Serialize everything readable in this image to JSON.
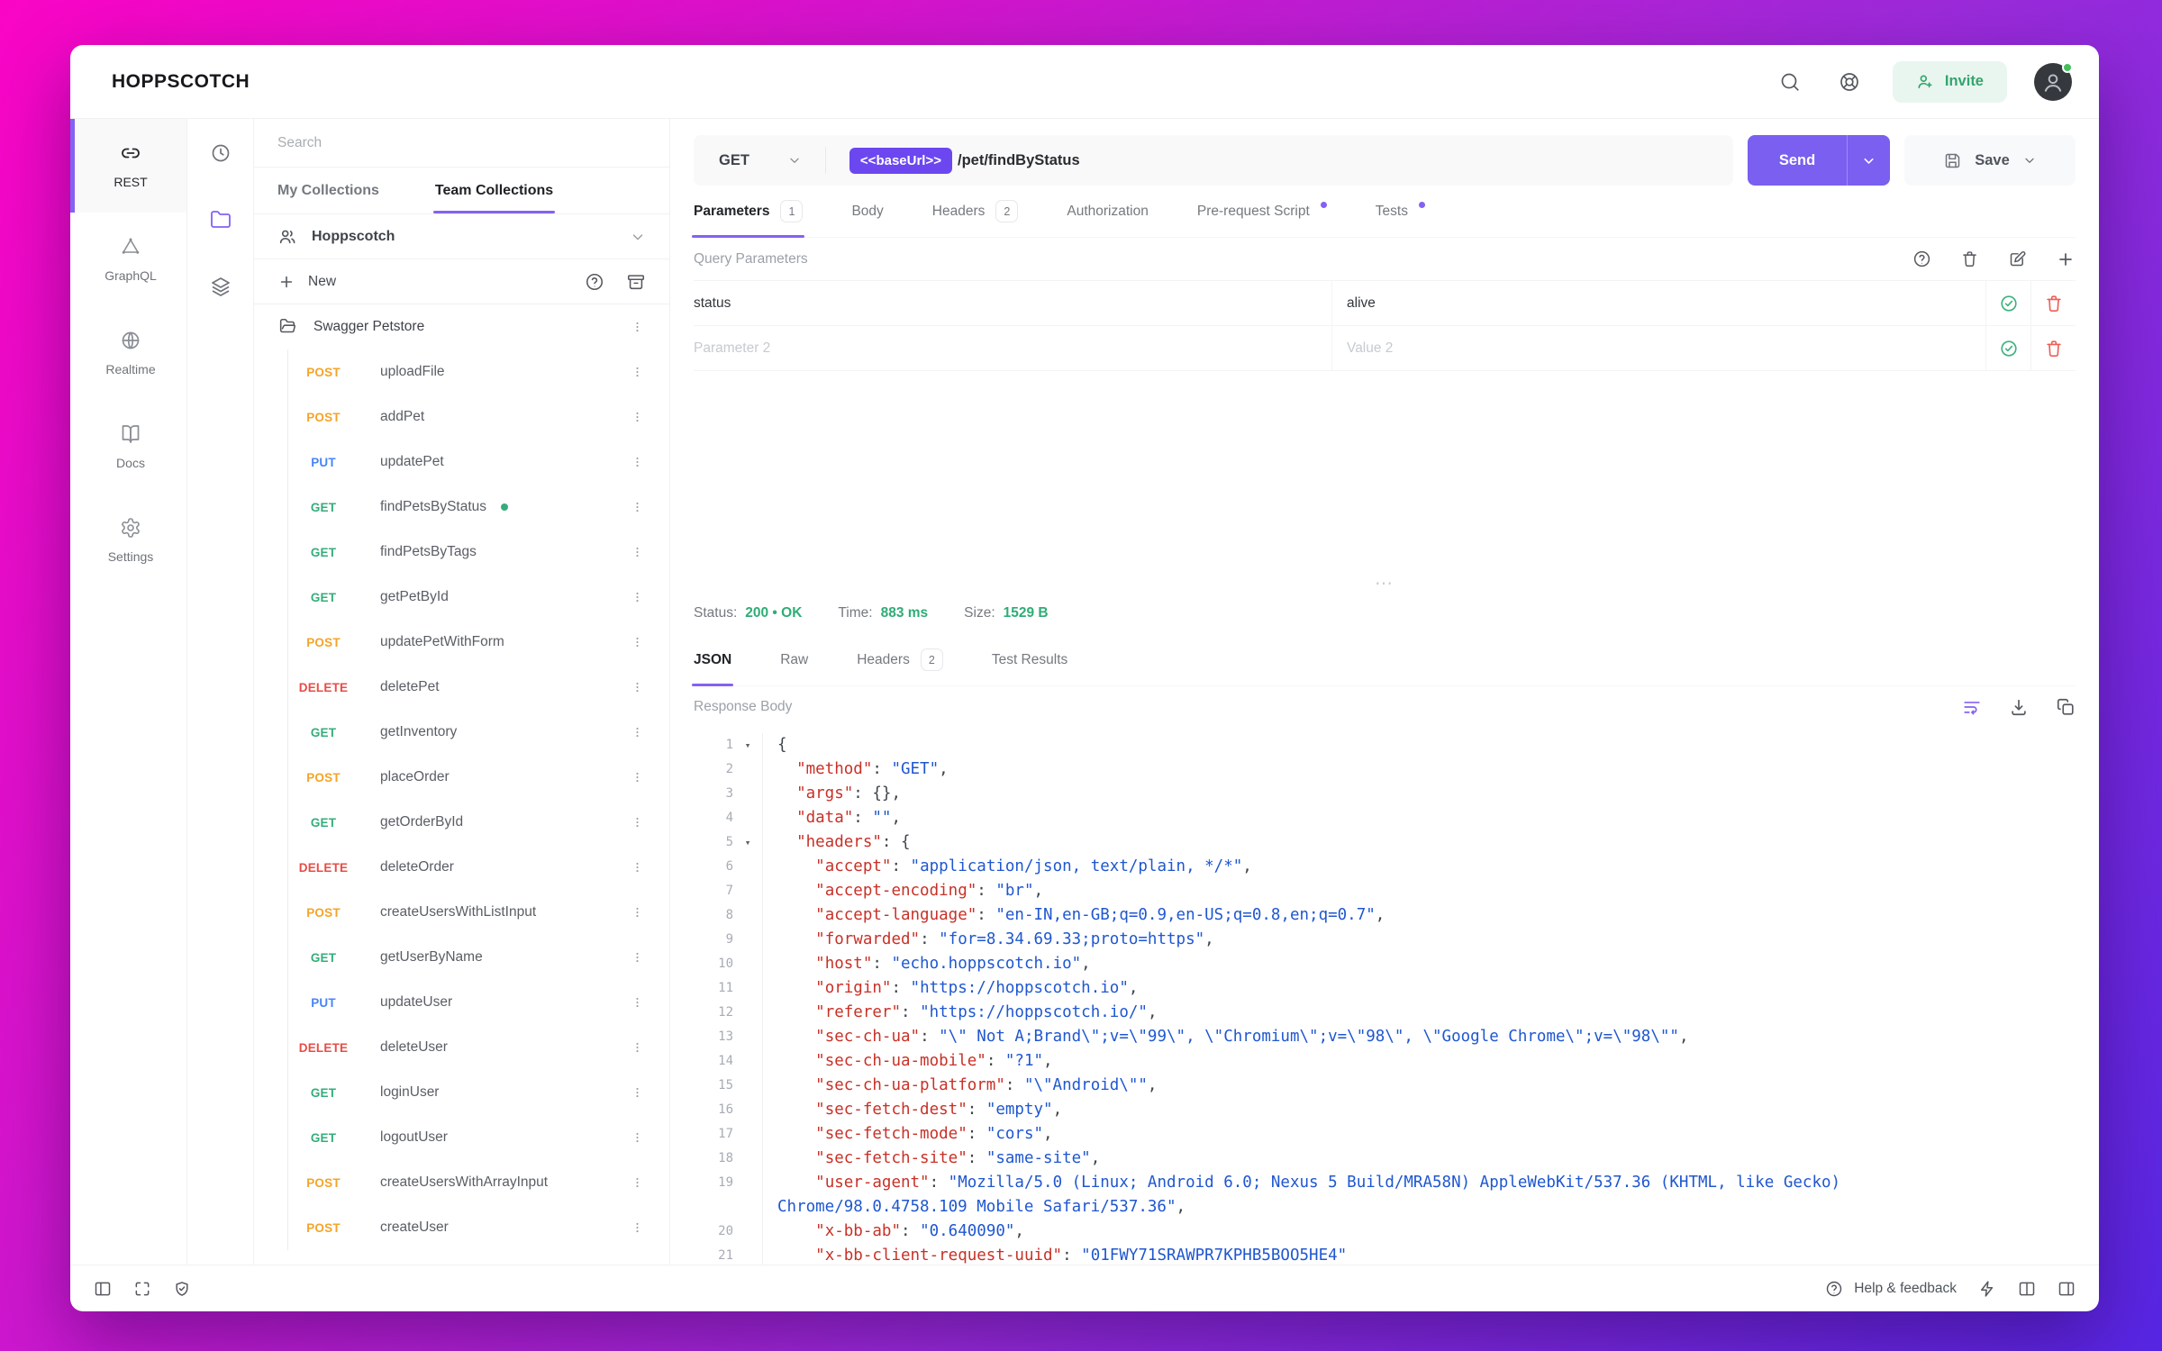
{
  "colors": {
    "accent_purple": "#7A5FF0",
    "pill_purple": "#6C47F0",
    "success_green": "#2EAD76",
    "invite_green": "#34A46E",
    "method_get": "#34AD7B",
    "method_post": "#F4A42A",
    "method_put": "#4885F7",
    "method_delete": "#E74C45",
    "code_key_red": "#C83127",
    "code_string_blue": "#1F57D0"
  },
  "topbar": {
    "logo": "HOPPSCOTCH",
    "invite_label": "Invite"
  },
  "nav": {
    "items": [
      {
        "label": "REST",
        "active": true
      },
      {
        "label": "GraphQL"
      },
      {
        "label": "Realtime"
      },
      {
        "label": "Docs"
      },
      {
        "label": "Settings"
      }
    ]
  },
  "collections": {
    "search_placeholder": "Search",
    "tabs": [
      {
        "label": "My Collections"
      },
      {
        "label": "Team Collections",
        "active": true
      }
    ],
    "team_name": "Hoppscotch",
    "new_label": "New",
    "folder_name": "Swagger Petstore",
    "requests": [
      {
        "method": "POST",
        "name": "uploadFile"
      },
      {
        "method": "POST",
        "name": "addPet"
      },
      {
        "method": "PUT",
        "name": "updatePet"
      },
      {
        "method": "GET",
        "name": "findPetsByStatus",
        "dot": true
      },
      {
        "method": "GET",
        "name": "findPetsByTags"
      },
      {
        "method": "GET",
        "name": "getPetById"
      },
      {
        "method": "POST",
        "name": "updatePetWithForm"
      },
      {
        "method": "DELETE",
        "name": "deletePet"
      },
      {
        "method": "GET",
        "name": "getInventory"
      },
      {
        "method": "POST",
        "name": "placeOrder"
      },
      {
        "method": "GET",
        "name": "getOrderById"
      },
      {
        "method": "DELETE",
        "name": "deleteOrder"
      },
      {
        "method": "POST",
        "name": "createUsersWithListInput"
      },
      {
        "method": "GET",
        "name": "getUserByName"
      },
      {
        "method": "PUT",
        "name": "updateUser"
      },
      {
        "method": "DELETE",
        "name": "deleteUser"
      },
      {
        "method": "GET",
        "name": "loginUser"
      },
      {
        "method": "GET",
        "name": "logoutUser"
      },
      {
        "method": "POST",
        "name": "createUsersWithArrayInput"
      },
      {
        "method": "POST",
        "name": "createUser"
      }
    ]
  },
  "request": {
    "method": "GET",
    "url_variable": "<<baseUrl>>",
    "url_path": "/pet/findByStatus",
    "send_label": "Send",
    "save_label": "Save",
    "tabs": [
      {
        "label": "Parameters",
        "badge": "1",
        "active": true
      },
      {
        "label": "Body"
      },
      {
        "label": "Headers",
        "badge": "2"
      },
      {
        "label": "Authorization"
      },
      {
        "label": "Pre-request Script",
        "dot": true
      },
      {
        "label": "Tests",
        "dot": true
      }
    ],
    "section_title": "Query Parameters",
    "params": [
      {
        "key": "status",
        "value": "alive"
      },
      {
        "key_placeholder": "Parameter 2",
        "value_placeholder": "Value 2"
      }
    ]
  },
  "response": {
    "status_label": "Status:",
    "status_value": "200 • OK",
    "time_label": "Time:",
    "time_value": "883 ms",
    "size_label": "Size:",
    "size_value": "1529 B",
    "tabs": [
      {
        "label": "JSON",
        "active": true
      },
      {
        "label": "Raw"
      },
      {
        "label": "Headers",
        "badge": "2"
      },
      {
        "label": "Test Results"
      }
    ],
    "body_label": "Response Body",
    "code_lines": [
      {
        "n": "1",
        "fold": true,
        "parts": [
          [
            "p",
            "{"
          ]
        ]
      },
      {
        "n": "2",
        "parts": [
          [
            "p",
            "  "
          ],
          [
            "k",
            "\"method\""
          ],
          [
            "p",
            ": "
          ],
          [
            "s",
            "\"GET\""
          ],
          [
            "p",
            ","
          ]
        ]
      },
      {
        "n": "3",
        "parts": [
          [
            "p",
            "  "
          ],
          [
            "k",
            "\"args\""
          ],
          [
            "p",
            ": {},"
          ]
        ]
      },
      {
        "n": "4",
        "parts": [
          [
            "p",
            "  "
          ],
          [
            "k",
            "\"data\""
          ],
          [
            "p",
            ": "
          ],
          [
            "s",
            "\"\""
          ],
          [
            "p",
            ","
          ]
        ]
      },
      {
        "n": "5",
        "fold": true,
        "parts": [
          [
            "p",
            "  "
          ],
          [
            "k",
            "\"headers\""
          ],
          [
            "p",
            ": {"
          ]
        ]
      },
      {
        "n": "6",
        "parts": [
          [
            "p",
            "    "
          ],
          [
            "k",
            "\"accept\""
          ],
          [
            "p",
            ": "
          ],
          [
            "s",
            "\"application/json, text/plain, */*\""
          ],
          [
            "p",
            ","
          ]
        ]
      },
      {
        "n": "7",
        "parts": [
          [
            "p",
            "    "
          ],
          [
            "k",
            "\"accept-encoding\""
          ],
          [
            "p",
            ": "
          ],
          [
            "s",
            "\"br\""
          ],
          [
            "p",
            ","
          ]
        ]
      },
      {
        "n": "8",
        "parts": [
          [
            "p",
            "    "
          ],
          [
            "k",
            "\"accept-language\""
          ],
          [
            "p",
            ": "
          ],
          [
            "s",
            "\"en-IN,en-GB;q=0.9,en-US;q=0.8,en;q=0.7\""
          ],
          [
            "p",
            ","
          ]
        ]
      },
      {
        "n": "9",
        "parts": [
          [
            "p",
            "    "
          ],
          [
            "k",
            "\"forwarded\""
          ],
          [
            "p",
            ": "
          ],
          [
            "s",
            "\"for=8.34.69.33;proto=https\""
          ],
          [
            "p",
            ","
          ]
        ]
      },
      {
        "n": "10",
        "parts": [
          [
            "p",
            "    "
          ],
          [
            "k",
            "\"host\""
          ],
          [
            "p",
            ": "
          ],
          [
            "s",
            "\"echo.hoppscotch.io\""
          ],
          [
            "p",
            ","
          ]
        ]
      },
      {
        "n": "11",
        "parts": [
          [
            "p",
            "    "
          ],
          [
            "k",
            "\"origin\""
          ],
          [
            "p",
            ": "
          ],
          [
            "s",
            "\"https://hoppscotch.io\""
          ],
          [
            "p",
            ","
          ]
        ]
      },
      {
        "n": "12",
        "parts": [
          [
            "p",
            "    "
          ],
          [
            "k",
            "\"referer\""
          ],
          [
            "p",
            ": "
          ],
          [
            "s",
            "\"https://hoppscotch.io/\""
          ],
          [
            "p",
            ","
          ]
        ]
      },
      {
        "n": "13",
        "parts": [
          [
            "p",
            "    "
          ],
          [
            "k",
            "\"sec-ch-ua\""
          ],
          [
            "p",
            ": "
          ],
          [
            "s",
            "\"\\\" Not A;Brand\\\";v=\\\"99\\\", \\\"Chromium\\\";v=\\\"98\\\", \\\"Google Chrome\\\";v=\\\"98\\\"\""
          ],
          [
            "p",
            ","
          ]
        ]
      },
      {
        "n": "14",
        "parts": [
          [
            "p",
            "    "
          ],
          [
            "k",
            "\"sec-ch-ua-mobile\""
          ],
          [
            "p",
            ": "
          ],
          [
            "s",
            "\"?1\""
          ],
          [
            "p",
            ","
          ]
        ]
      },
      {
        "n": "15",
        "parts": [
          [
            "p",
            "    "
          ],
          [
            "k",
            "\"sec-ch-ua-platform\""
          ],
          [
            "p",
            ": "
          ],
          [
            "s",
            "\"\\\"Android\\\"\""
          ],
          [
            "p",
            ","
          ]
        ]
      },
      {
        "n": "16",
        "parts": [
          [
            "p",
            "    "
          ],
          [
            "k",
            "\"sec-fetch-dest\""
          ],
          [
            "p",
            ": "
          ],
          [
            "s",
            "\"empty\""
          ],
          [
            "p",
            ","
          ]
        ]
      },
      {
        "n": "17",
        "parts": [
          [
            "p",
            "    "
          ],
          [
            "k",
            "\"sec-fetch-mode\""
          ],
          [
            "p",
            ": "
          ],
          [
            "s",
            "\"cors\""
          ],
          [
            "p",
            ","
          ]
        ]
      },
      {
        "n": "18",
        "parts": [
          [
            "p",
            "    "
          ],
          [
            "k",
            "\"sec-fetch-site\""
          ],
          [
            "p",
            ": "
          ],
          [
            "s",
            "\"same-site\""
          ],
          [
            "p",
            ","
          ]
        ]
      },
      {
        "n": "19",
        "parts": [
          [
            "p",
            "    "
          ],
          [
            "k",
            "\"user-agent\""
          ],
          [
            "p",
            ": "
          ],
          [
            "s",
            "\"Mozilla/5.0 (Linux; Android 6.0; Nexus 5 Build/MRA58N) AppleWebKit/537.36 (KHTML, like Gecko)"
          ]
        ]
      },
      {
        "n": "",
        "parts": [
          [
            "s",
            "Chrome/98.0.4758.109 Mobile Safari/537.36\""
          ],
          [
            "p",
            ","
          ]
        ]
      },
      {
        "n": "20",
        "parts": [
          [
            "p",
            "    "
          ],
          [
            "k",
            "\"x-bb-ab\""
          ],
          [
            "p",
            ": "
          ],
          [
            "s",
            "\"0.640090\""
          ],
          [
            "p",
            ","
          ]
        ]
      },
      {
        "n": "21",
        "parts": [
          [
            "p",
            "    "
          ],
          [
            "k",
            "\"x-bb-client-request-uuid\""
          ],
          [
            "p",
            ": "
          ],
          [
            "s",
            "\"01FWY71SRAWPR7KPHB5BOO5HE4\""
          ]
        ]
      }
    ]
  },
  "footer": {
    "help_label": "Help & feedback"
  }
}
